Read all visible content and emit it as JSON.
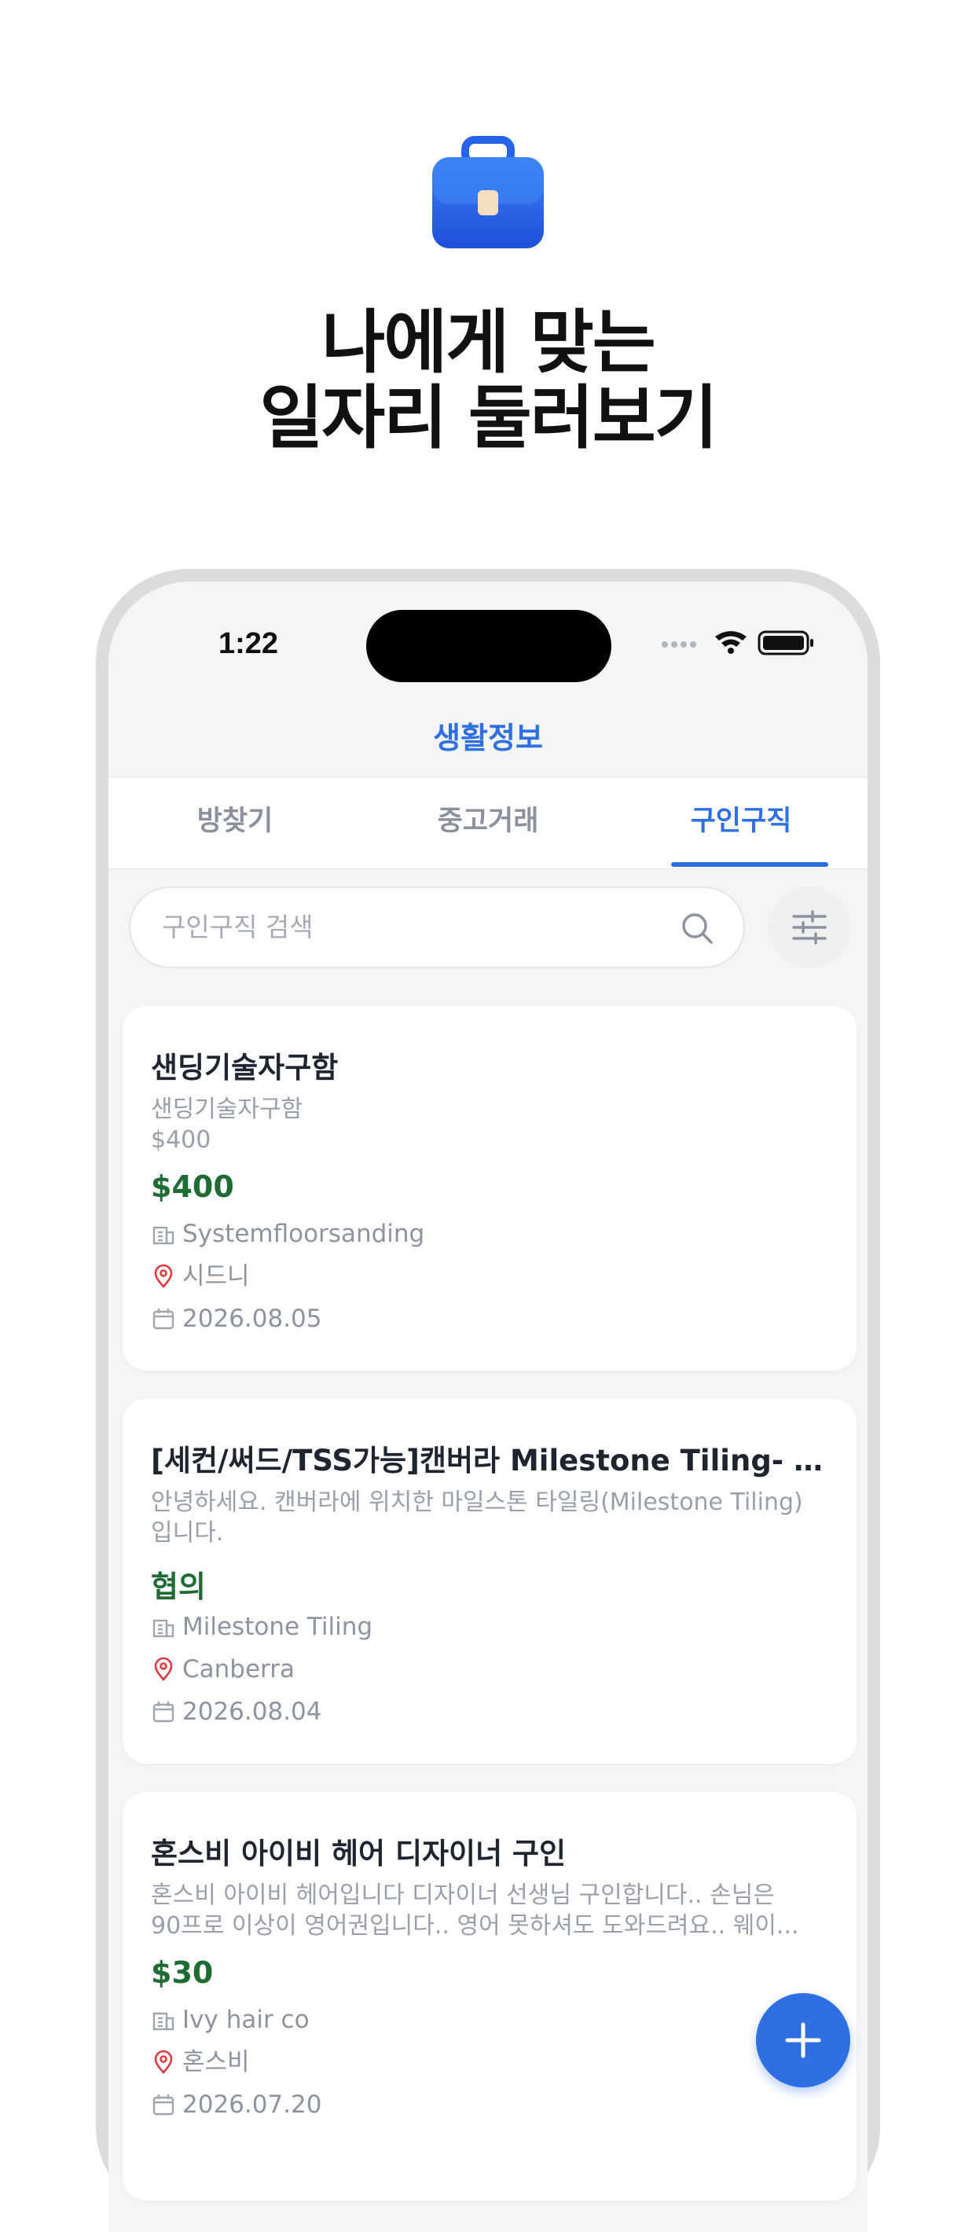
{
  "headline": {
    "line1": "나에게 맞는",
    "line2": "일자리 둘러보기"
  },
  "status_bar": {
    "time": "1:22"
  },
  "app": {
    "title": "생활정보"
  },
  "tabs": [
    {
      "label": "방찾기",
      "active": false
    },
    {
      "label": "중고거래",
      "active": false
    },
    {
      "label": "구인구직",
      "active": true
    }
  ],
  "search": {
    "placeholder": "구인구직 검색"
  },
  "listings": [
    {
      "title": "샌딩기술자구함",
      "description": "샌딩기술자구함\n$400",
      "price": "$400",
      "company": "Systemfloorsanding",
      "location": "시드니",
      "date": "2026.08.05"
    },
    {
      "title": "[세컨/써드/TSS가능]캔버라 Milestone Tiling- 직...",
      "description": "안녕하세요. 캔버라에 위치한 마일스톤 타일링(Milestone Tiling)\n입니다.",
      "price": "협의",
      "company": "Milestone Tiling",
      "location": "Canberra",
      "date": "2026.08.04"
    },
    {
      "title": "혼스비 아이비 헤어 디자이너 구인",
      "description": "혼스비 아이비 헤어입니다 디자이너 선생님 구인합니다.. 손님은\n90프로 이상이 영어권입니다.. 영어 못하셔도 도와드려요.. 웨이...",
      "price": "$30",
      "company": "Ivy hair co",
      "location": "혼스비",
      "date": "2026.07.20"
    }
  ],
  "colors": {
    "accent": "#2f6fe4",
    "price": "#1e6b33",
    "location_pin": "#e0393e"
  }
}
